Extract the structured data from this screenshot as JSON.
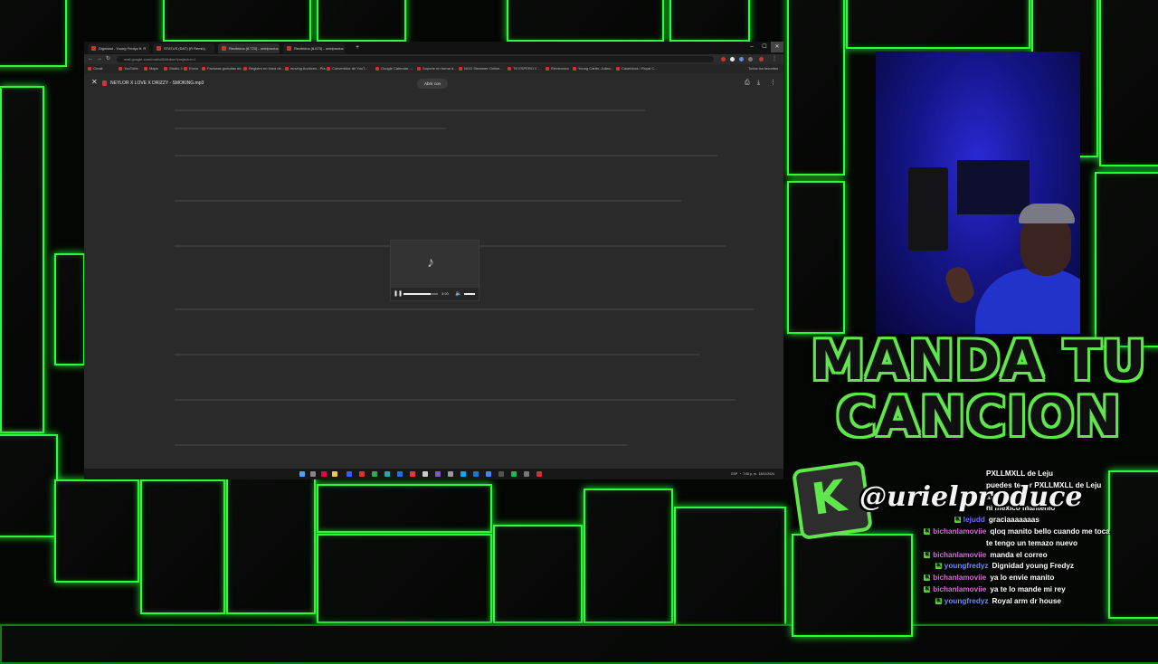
{
  "browser": {
    "tabs": [
      {
        "label": "Dignidad - Young Fredyz ft. R"
      },
      {
        "label": "STATUS (DAT) (R Remix)"
      },
      {
        "label": "Recibidos (8.723) - urielproduc"
      },
      {
        "label": "Recibidos (8.673) - urielproduc"
      }
    ],
    "new_tab_label": "+",
    "url": "mail.google.com/mail/u/0/#inbox?projector=1",
    "bookmarks": [
      "Gmail",
      "YouTube",
      "Maps",
      "Studio J",
      "Envío",
      "Facturas gratuitas de...",
      "Registro en línea de...",
      "moving Archives - Pla...",
      "Convertidor de YouT...",
      "Google Calendar -...",
      "Soporte en forma d...",
      "NGO Streamer Online...",
      "TE ESPERO // ...",
      "Electronico",
      "Young Carter, Julian...",
      "Caseblock / Royal C..."
    ],
    "bookmarks_right": "Todos los favoritos",
    "win_controls": {
      "minimize": "–",
      "maximize": "☐",
      "close": "✕"
    }
  },
  "viewer": {
    "close": "✕",
    "file_name": "NEYLOR X LOVE X DRIZZY - SMOKING.mp3",
    "open_with": "Abrir con",
    "player": {
      "time": "3:20",
      "progress": 0.8,
      "volume": 1.0
    }
  },
  "taskbar": {
    "tray_time": "7:06 p. m.",
    "tray_date": "18/11/2024",
    "tray_lang": "ESP"
  },
  "overlay": {
    "title_line1": "MANDA TU",
    "title_line2": "CANCION",
    "badge_letter": "K",
    "handle": "@urielproduce"
  },
  "chat": [
    {
      "user": "",
      "text": "PXLLMXLL de Leju",
      "user_color": "#ffffff",
      "icon": false
    },
    {
      "user": "",
      "text": "puedes tener PXLLMXLL de Leju",
      "user_color": "#ffffff",
      "icon": false
    },
    {
      "user": "",
      "text": "ad",
      "user_color": "#ffffff",
      "icon": false
    },
    {
      "user": "",
      "text": "ni mexico mantenlo",
      "user_color": "#ffffff",
      "icon": false
    },
    {
      "user": "lejudd",
      "text": "graciaaaaaaas",
      "user_color": "#6f6fff",
      "icon": true
    },
    {
      "user": "bichanlamoviie",
      "text": "qloq manito bello cuando me toca",
      "user_color": "#d36fd3",
      "icon": true
    },
    {
      "user": "",
      "text": "te tengo un temazo nuevo",
      "user_color": "#ffffff",
      "icon": false
    },
    {
      "user": "bichanlamoviie",
      "text": "manda el correo",
      "user_color": "#d36fd3",
      "icon": true
    },
    {
      "user": "youngfredyz",
      "text": "Dignidad young Fredyz",
      "user_color": "#6f8cff",
      "icon": true
    },
    {
      "user": "bichanlamoviie",
      "text": "ya lo envie manito",
      "user_color": "#d36fd3",
      "icon": true
    },
    {
      "user": "bichanlamoviie",
      "text": "ya te lo mande mi rey",
      "user_color": "#d36fd3",
      "icon": true
    },
    {
      "user": "youngfredyz",
      "text": "Royal arm dr house",
      "user_color": "#6f8cff",
      "icon": true
    }
  ],
  "colors": {
    "neon_green": "#2bff3a",
    "title_green": "#5fe64a",
    "gmail_red": "#d93025"
  },
  "icons": [
    "music-note-icon",
    "pause-icon",
    "volume-icon",
    "download-icon",
    "print-icon",
    "more-icon",
    "kick-logo-icon"
  ]
}
